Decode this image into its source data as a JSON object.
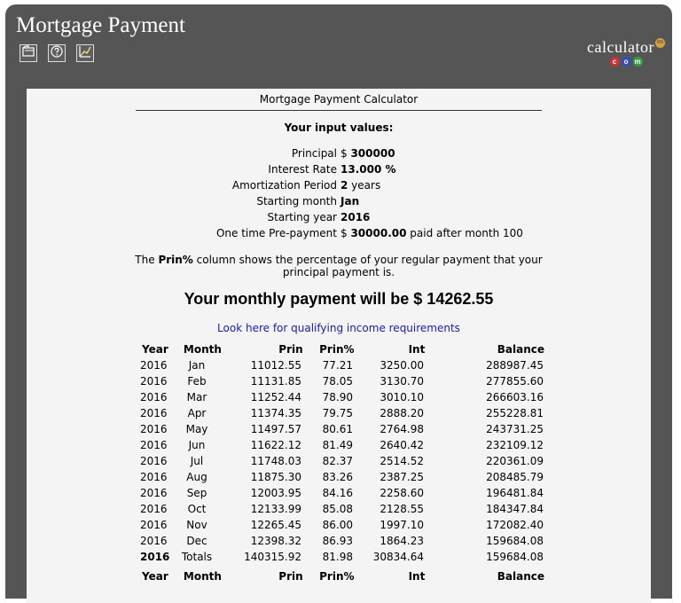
{
  "window": {
    "title": "Mortgage Payment",
    "toolbar": [
      {
        "name": "folder-icon"
      },
      {
        "name": "help-icon"
      },
      {
        "name": "chart-icon"
      }
    ],
    "logo": {
      "word": "calculator",
      "tm": "tm",
      "dots": [
        "c",
        "o",
        "m"
      ]
    }
  },
  "calculator": {
    "title": "Mortgage Payment Calculator",
    "inputs_heading": "Your input values:",
    "inputs": [
      {
        "label": "Principal",
        "prefix": "$ ",
        "value": "300000",
        "suffix": ""
      },
      {
        "label": "Interest Rate",
        "prefix": "",
        "value": "13.000 %",
        "suffix": ""
      },
      {
        "label": "Amortization Period",
        "prefix": "",
        "value": "2",
        "suffix": " years"
      },
      {
        "label": "Starting month",
        "prefix": "",
        "value": "Jan",
        "suffix": ""
      },
      {
        "label": "Starting year",
        "prefix": "",
        "value": "2016",
        "suffix": ""
      },
      {
        "label": "One time Pre-payment",
        "prefix": "$ ",
        "value": "30000.00",
        "suffix": " paid after month 100"
      }
    ],
    "note_before": "The ",
    "note_bold": "Prin%",
    "note_after": " column shows the percentage of your regular payment that your principal payment is.",
    "payment_text": "Your monthly payment will be $ 14262.55",
    "income_link": "Look here for qualifying income requirements"
  },
  "table": {
    "headers": {
      "year": "Year",
      "month": "Month",
      "prin": "Prin",
      "prin_pct": "Prin%",
      "int": "Int",
      "balance": "Balance"
    },
    "rows": [
      {
        "year": "2016",
        "month": "Jan",
        "prin": "11012.55",
        "prin_pct": "77.21",
        "int": "3250.00",
        "balance": "288987.45"
      },
      {
        "year": "2016",
        "month": "Feb",
        "prin": "11131.85",
        "prin_pct": "78.05",
        "int": "3130.70",
        "balance": "277855.60"
      },
      {
        "year": "2016",
        "month": "Mar",
        "prin": "11252.44",
        "prin_pct": "78.90",
        "int": "3010.10",
        "balance": "266603.16"
      },
      {
        "year": "2016",
        "month": "Apr",
        "prin": "11374.35",
        "prin_pct": "79.75",
        "int": "2888.20",
        "balance": "255228.81"
      },
      {
        "year": "2016",
        "month": "May",
        "prin": "11497.57",
        "prin_pct": "80.61",
        "int": "2764.98",
        "balance": "243731.25"
      },
      {
        "year": "2016",
        "month": "Jun",
        "prin": "11622.12",
        "prin_pct": "81.49",
        "int": "2640.42",
        "balance": "232109.12"
      },
      {
        "year": "2016",
        "month": "Jul",
        "prin": "11748.03",
        "prin_pct": "82.37",
        "int": "2514.52",
        "balance": "220361.09"
      },
      {
        "year": "2016",
        "month": "Aug",
        "prin": "11875.30",
        "prin_pct": "83.26",
        "int": "2387.25",
        "balance": "208485.79"
      },
      {
        "year": "2016",
        "month": "Sep",
        "prin": "12003.95",
        "prin_pct": "84.16",
        "int": "2258.60",
        "balance": "196481.84"
      },
      {
        "year": "2016",
        "month": "Oct",
        "prin": "12133.99",
        "prin_pct": "85.08",
        "int": "2128.55",
        "balance": "184347.84"
      },
      {
        "year": "2016",
        "month": "Nov",
        "prin": "12265.45",
        "prin_pct": "86.00",
        "int": "1997.10",
        "balance": "172082.40"
      },
      {
        "year": "2016",
        "month": "Dec",
        "prin": "12398.32",
        "prin_pct": "86.93",
        "int": "1864.23",
        "balance": "159684.08"
      }
    ],
    "total": {
      "year": "2016",
      "month": "Totals",
      "prin": "140315.92",
      "prin_pct": "81.98",
      "int": "30834.64",
      "balance": "159684.08"
    },
    "next_headers": {
      "year": "Year",
      "month": "Month",
      "prin": "Prin",
      "prin_pct": "Prin%",
      "int": "Int",
      "balance": "Balance"
    }
  }
}
